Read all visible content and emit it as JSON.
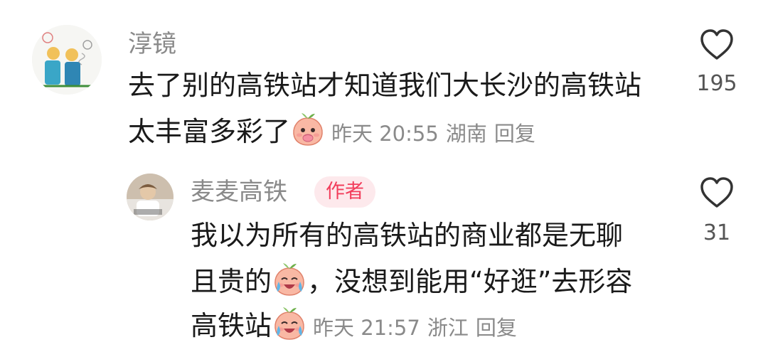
{
  "comments": [
    {
      "username": "淳镜",
      "line1": "去了别的高铁站才知道我们大长沙的高铁站",
      "line2": "太丰富多彩了",
      "emoji": "peach-covering-mouth-emoji",
      "time": "昨天 20:55",
      "location": "湖南",
      "reply_label": "回复",
      "like_icon": "heart-outline-icon",
      "like_count": "195"
    },
    {
      "username": "麦麦高铁",
      "badge": "作者",
      "line1": "我以为所有的高铁站的商业都是无聊",
      "line2a": "且贵的",
      "line2b": "，没想到能用“好逛”去形容",
      "line3": "高铁站",
      "emoji": "peach-crying-laughing-emoji",
      "time": "昨天 21:57",
      "location": "浙江",
      "reply_label": "回复",
      "like_icon": "heart-outline-icon",
      "like_count": "31"
    }
  ],
  "colors": {
    "username": "#8a8a8a",
    "body_text": "#1a1a1a",
    "badge_bg": "#fde9ec",
    "badge_text": "#f23d5b",
    "peach": "#f7b29b"
  }
}
